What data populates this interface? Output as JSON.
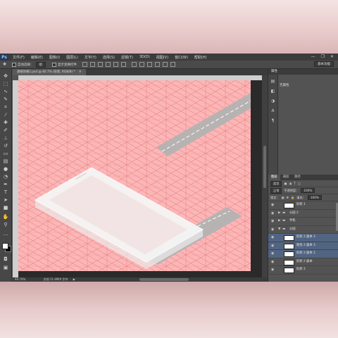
{
  "app": {
    "logo": "Ps",
    "menu": [
      "文件(F)",
      "编辑(E)",
      "图像(I)",
      "图层(L)",
      "文字(Y)",
      "选择(S)",
      "滤镜(T)",
      "3D(D)",
      "视图(V)",
      "窗口(W)",
      "帮助(H)"
    ],
    "window_controls": [
      "—",
      "❐",
      "✕"
    ]
  },
  "options": {
    "auto_select_label": "自动选择：",
    "auto_select_value": "组",
    "show_transform_label": "显示变换控件",
    "workspace": "基本功能"
  },
  "document": {
    "tab_title": "透视效果2.psd @ 40.7% (形状, RGB/8) *",
    "zoom": "40.74%",
    "doc_size": "文档:11.4M/0 字节"
  },
  "properties": {
    "title": "属性",
    "empty_text": "无属性"
  },
  "layers": {
    "tabs": [
      "图层",
      "通道",
      "路径"
    ],
    "kind_label": "类型",
    "blend_mode": "正常",
    "opacity_label": "不透明度：",
    "opacity_value": "100%",
    "lock_label": "锁定：",
    "fill_label": "填充：",
    "fill_value": "100%",
    "items": [
      {
        "name": "形状 1",
        "type": "shape",
        "indent": 1,
        "selected": false
      },
      {
        "name": "公园 2",
        "type": "group",
        "indent": 0,
        "selected": false
      },
      {
        "name": "手机",
        "type": "group",
        "indent": 0,
        "selected": false
      },
      {
        "name": "公园",
        "type": "group",
        "indent": 0,
        "selected": false
      },
      {
        "name": "形状 2 副本 3",
        "type": "shape",
        "indent": 1,
        "selected": true
      },
      {
        "name": "矩形 2 副本 3",
        "type": "shape",
        "indent": 1,
        "selected": true
      },
      {
        "name": "形状 2 副本 2",
        "type": "shape",
        "indent": 1,
        "selected": true
      },
      {
        "name": "形状 2 副本",
        "type": "shape",
        "indent": 1,
        "selected": false
      },
      {
        "name": "形状 2",
        "type": "shape",
        "indent": 1,
        "selected": false
      }
    ]
  },
  "colors": {
    "canvas_pink": "#fcb6b6",
    "grid_line": "#e8898d",
    "road_gray": "#b3b3b3",
    "selection_blue": "#516482"
  }
}
